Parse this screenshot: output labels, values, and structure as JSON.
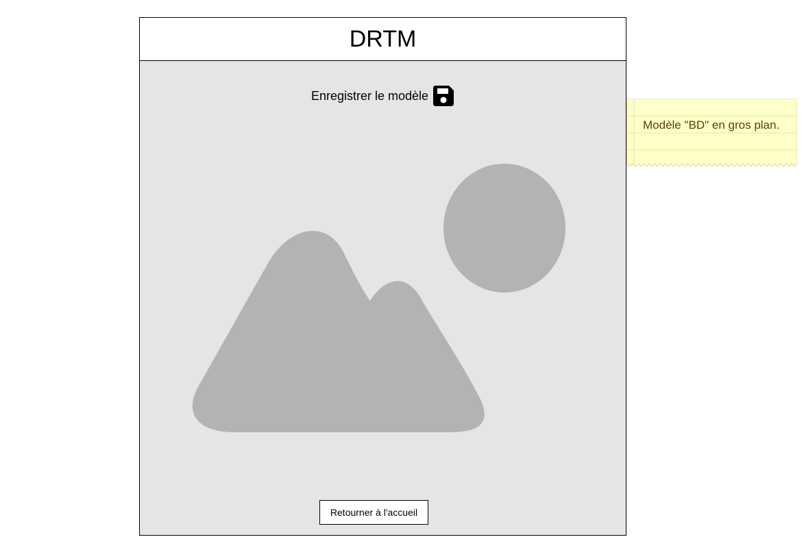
{
  "header": {
    "title": "DRTM"
  },
  "save": {
    "label": "Enregistrer le modèle",
    "icon": "save-icon"
  },
  "image": {
    "icon": "image-placeholder-icon",
    "color": "#b3b3b3"
  },
  "footer": {
    "home_button_label": "Retourner à l'accueil"
  },
  "note": {
    "text": "Modèle \"BD\" en gros plan.",
    "background": "#ffffc8"
  }
}
